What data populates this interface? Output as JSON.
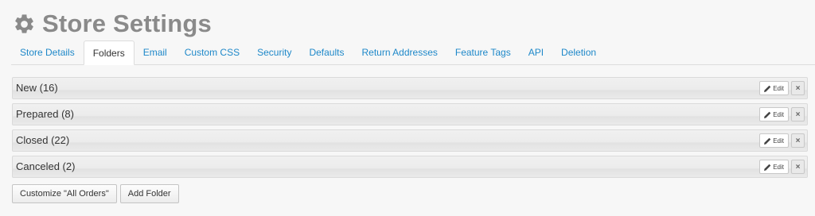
{
  "header": {
    "title": "Store Settings",
    "icon": "gear-icon"
  },
  "tabs": [
    {
      "label": "Store Details",
      "active": false
    },
    {
      "label": "Folders",
      "active": true
    },
    {
      "label": "Email",
      "active": false
    },
    {
      "label": "Custom CSS",
      "active": false
    },
    {
      "label": "Security",
      "active": false
    },
    {
      "label": "Defaults",
      "active": false
    },
    {
      "label": "Return Addresses",
      "active": false
    },
    {
      "label": "Feature Tags",
      "active": false
    },
    {
      "label": "API",
      "active": false
    },
    {
      "label": "Deletion",
      "active": false
    }
  ],
  "folders": [
    {
      "name": "New (16)"
    },
    {
      "name": "Prepared (8)"
    },
    {
      "name": "Closed (22)"
    },
    {
      "name": "Canceled (2)"
    }
  ],
  "folder_actions": {
    "edit_label": "Edit",
    "remove_label": "×"
  },
  "actions": {
    "customize_label": "Customize \"All Orders\"",
    "add_folder_label": "Add Folder"
  },
  "colors": {
    "link": "#1e88c9",
    "title": "#8a8a8a"
  }
}
